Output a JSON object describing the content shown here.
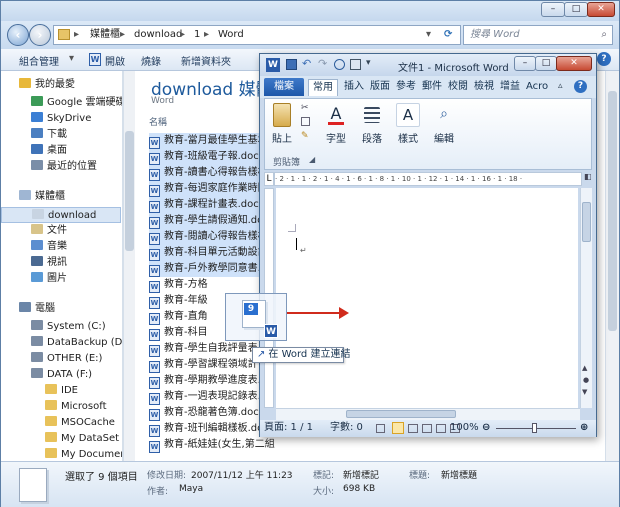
{
  "explorer": {
    "breadcrumb": [
      "媒體櫃",
      "download",
      "1",
      "Word"
    ],
    "search_placeholder": "搜尋 Word",
    "toolbar": {
      "organize": "組合管理",
      "open": "開啟",
      "burn": "燒錄",
      "new_folder": "新增資料夾"
    },
    "nav": [
      {
        "label": "我的最愛",
        "icon": "star-icon",
        "color": "#e8b83a"
      },
      {
        "label": "Google 雲端硬碟",
        "icon": "drive-icon",
        "color": "#3c9b58"
      },
      {
        "label": "SkyDrive",
        "icon": "cloud-icon",
        "color": "#3b7fd4"
      },
      {
        "label": "下載",
        "icon": "download-folder-icon",
        "color": "#4b7fc1"
      },
      {
        "label": "桌面",
        "icon": "desktop-icon",
        "color": "#3f73b8"
      },
      {
        "label": "最近的位置",
        "icon": "recent-places-icon",
        "color": "#7a8ea8"
      },
      {
        "label": "媒體櫃",
        "icon": "library-icon",
        "color": "#9fb6d3"
      },
      {
        "label": "download",
        "icon": "folder-icon",
        "color": "#c8d4e2"
      },
      {
        "label": "文件",
        "icon": "documents-icon",
        "color": "#d8c48a"
      },
      {
        "label": "音樂",
        "icon": "music-icon",
        "color": "#5c8ed0"
      },
      {
        "label": "視訊",
        "icon": "video-icon",
        "color": "#4b6a92"
      },
      {
        "label": "圖片",
        "icon": "pictures-icon",
        "color": "#5a9ad6"
      },
      {
        "label": "電腦",
        "icon": "computer-icon",
        "color": "#6b86a8"
      },
      {
        "label": "System (C:)",
        "icon": "drive-c-icon",
        "color": "#7b8ca3"
      },
      {
        "label": "DataBackup (D:)",
        "icon": "drive-d-icon",
        "color": "#7b8ca3"
      },
      {
        "label": "OTHER (E:)",
        "icon": "drive-e-icon",
        "color": "#7b8ca3"
      },
      {
        "label": "DATA (F:)",
        "icon": "drive-f-icon",
        "color": "#7b8ca3"
      },
      {
        "label": "IDE",
        "icon": "folder-icon",
        "color": "#e8c25a"
      },
      {
        "label": "Microsoft",
        "icon": "folder-icon",
        "color": "#e8c25a"
      },
      {
        "label": "MSOCache",
        "icon": "folder-icon",
        "color": "#e8c25a"
      },
      {
        "label": "My DataSet",
        "icon": "folder-icon",
        "color": "#e8c25a"
      },
      {
        "label": "My Documents",
        "icon": "folder-icon",
        "color": "#e8c25a"
      }
    ],
    "library_title": "download 媒體櫃",
    "library_sub": "Word",
    "column_name": "名稱",
    "files": [
      "教育-當月最佳學生基本",
      "教育-班級電子報.doc",
      "教育-讀書心得報告樣板.d",
      "教育-每週家庭作業時間表",
      "教育-課程計畫表.doc",
      "教育-學生請假通知.doc",
      "教育-閱讀心得報告樣板.d",
      "教育-科目單元活動設計.d",
      "教育-戶外教學同意書.doc",
      "教育-方格",
      "教育-年級",
      "教育-直角",
      "教育-科目",
      "教育-學生自我評量表.doc",
      "教育-學習課程領域計",
      "教育-學期教學進度表.doc",
      "教育-一週表現記錄表.doc",
      "教育-恐龍著色簿.doc",
      "教育-班刊編輯樣板.doc",
      "教育-紙娃娃(女生,第二組"
    ],
    "selected_files": [
      0,
      1,
      2,
      3,
      4,
      5,
      6,
      7,
      8
    ],
    "details": {
      "summary": "選取了 9 個項目",
      "modified_label": "修改日期:",
      "modified_value": "2007/11/12 上午 11:23",
      "tags_label": "標記:",
      "tags_value": "新增標記",
      "title_label": "標題:",
      "title_value": "新增標題",
      "author_label": "作者:",
      "author_value": "Maya",
      "size_label": "大小:",
      "size_value": "698 KB"
    }
  },
  "word": {
    "title": "文件1 - Microsoft Word",
    "tabs": [
      "檔案",
      "常用",
      "插入",
      "版面",
      "參考",
      "郵件",
      "校閱",
      "檢視",
      "增益",
      "Acro"
    ],
    "ribbon": [
      {
        "label": "貼上",
        "icon": "paste-icon"
      },
      {
        "label": "字型",
        "icon": "font-icon"
      },
      {
        "label": "段落",
        "icon": "paragraph-icon"
      },
      {
        "label": "樣式",
        "icon": "styles-icon"
      },
      {
        "label": "編輯",
        "icon": "editing-icon"
      }
    ],
    "clipboard_label": "剪貼簿",
    "ruler_text": "· 2 · 1 · 1 · 2 · 1 · 4 · 1 · 6 · 1 · 8 · 1 · 10 · 1 · 12 · 1 · 14 · 1 · 16 · 1 · 18 ·",
    "status": {
      "page": "頁面: 1 / 1",
      "words": "字數: 0",
      "zoom": "100%"
    }
  },
  "drag": {
    "badge_count": "9",
    "tooltip": "在 Word 建立連結"
  }
}
